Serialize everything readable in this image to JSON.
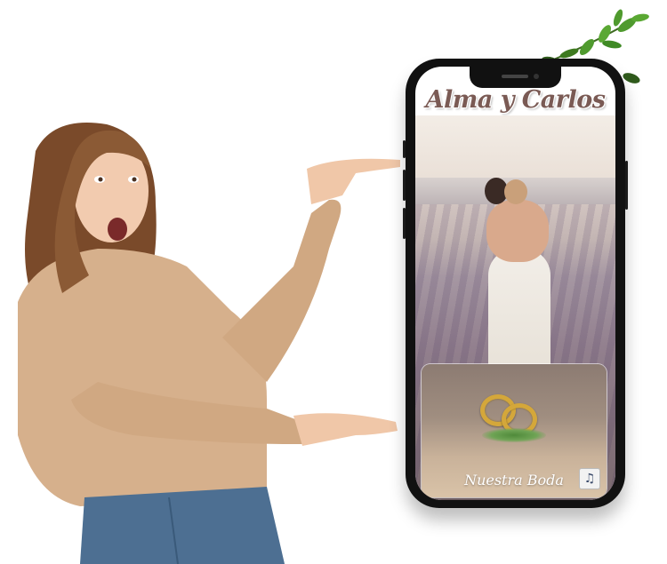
{
  "invitation": {
    "title": "Alma y Carlos",
    "card_label": "Nuestra Boda",
    "music_icon": "music-note-icon"
  },
  "colors": {
    "title": "#7a5a54",
    "sweater": "#d6b08c",
    "jeans": "#4d6f92",
    "rings": "#d4a73a",
    "leaves": "#4f9a2e"
  }
}
